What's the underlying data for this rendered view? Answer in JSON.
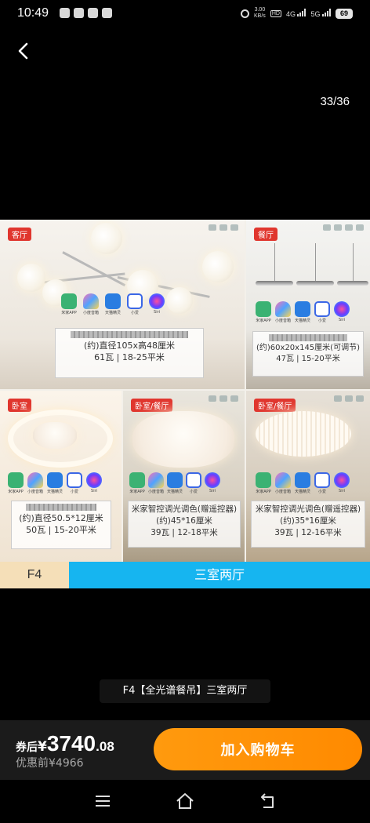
{
  "status_bar": {
    "time": "10:49",
    "net_speed_top": "3.00",
    "net_speed_bottom": "KB/s",
    "hd": "HD",
    "signal_1": "4G",
    "signal_2": "5G",
    "battery": "69"
  },
  "viewer": {
    "page_counter": "33/36",
    "back_icon": "chevron-left-icon"
  },
  "poster": {
    "panels": [
      {
        "room": "客厅",
        "line1": "(约)直径105x高48厘米",
        "line2": "61瓦 | 18-25平米"
      },
      {
        "room": "餐厅",
        "line1": "(约)60x20x145厘米(可调节)",
        "line2": "47瓦 | 15-20平米"
      },
      {
        "room": "卧室",
        "line1": "(约)直径50.5*12厘米",
        "line2": "50瓦 | 15-20平米"
      },
      {
        "room": "卧室/餐厅",
        "line0": "米家智控调光调色(赠遥控器)",
        "line1": "(约)45*16厘米",
        "line2": "39瓦 | 12-18平米"
      },
      {
        "room": "卧室/餐厅",
        "line0": "米家智控调光调色(赠遥控器)",
        "line1": "(约)35*16厘米",
        "line2": "39瓦 | 12-16平米"
      }
    ],
    "apps": [
      "米家APP",
      "小度音箱",
      "天猫精灵",
      "小爱",
      "Siri"
    ],
    "tab_left": "F4",
    "tab_right": "三室两厅"
  },
  "caption": "F4【全光谱餐吊】三室两厅",
  "purchase": {
    "price_prefix": "券后",
    "currency": "¥",
    "price_integer": "3740",
    "price_decimal": ".08",
    "original_price": "优惠前¥4966",
    "cart_button": "加入购物车"
  },
  "colors": {
    "accent_orange": "#ff9000",
    "room_tab_blue": "#16b5f0",
    "room_tag_red": "#e0362e"
  },
  "nav": [
    "menu-icon",
    "home-icon",
    "back-icon"
  ]
}
